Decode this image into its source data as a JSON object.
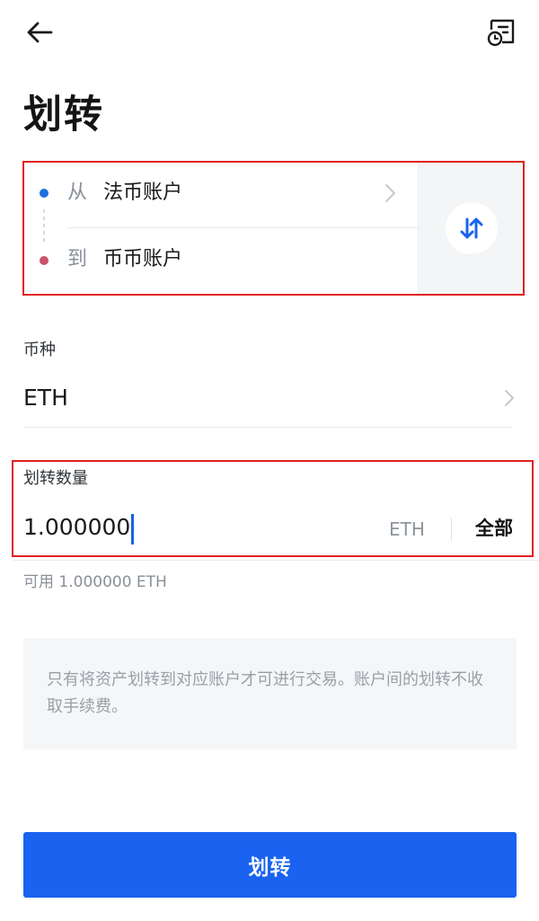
{
  "header": {
    "back_icon": "arrow-left-icon",
    "history_icon": "transfer-history-icon",
    "title": "划转"
  },
  "accounts": {
    "from": {
      "prefix": "从",
      "name": "法币账户",
      "dot_color": "#1f6fde"
    },
    "to": {
      "prefix": "到",
      "name": "币币账户",
      "dot_color": "#c9536b"
    },
    "swap_icon": "swap-arrows-icon"
  },
  "currency": {
    "label": "币种",
    "value": "ETH"
  },
  "amount": {
    "label": "划转数量",
    "value": "1.000000",
    "unit": "ETH",
    "all_label": "全部",
    "available": "可用 1.000000 ETH"
  },
  "notice": {
    "text": "只有将资产划转到对应账户才可进行交易。账户间的划转不收取手续费。"
  },
  "submit": {
    "label": "划转"
  },
  "colors": {
    "primary": "#1a63f0",
    "highlight": "#e02020"
  }
}
